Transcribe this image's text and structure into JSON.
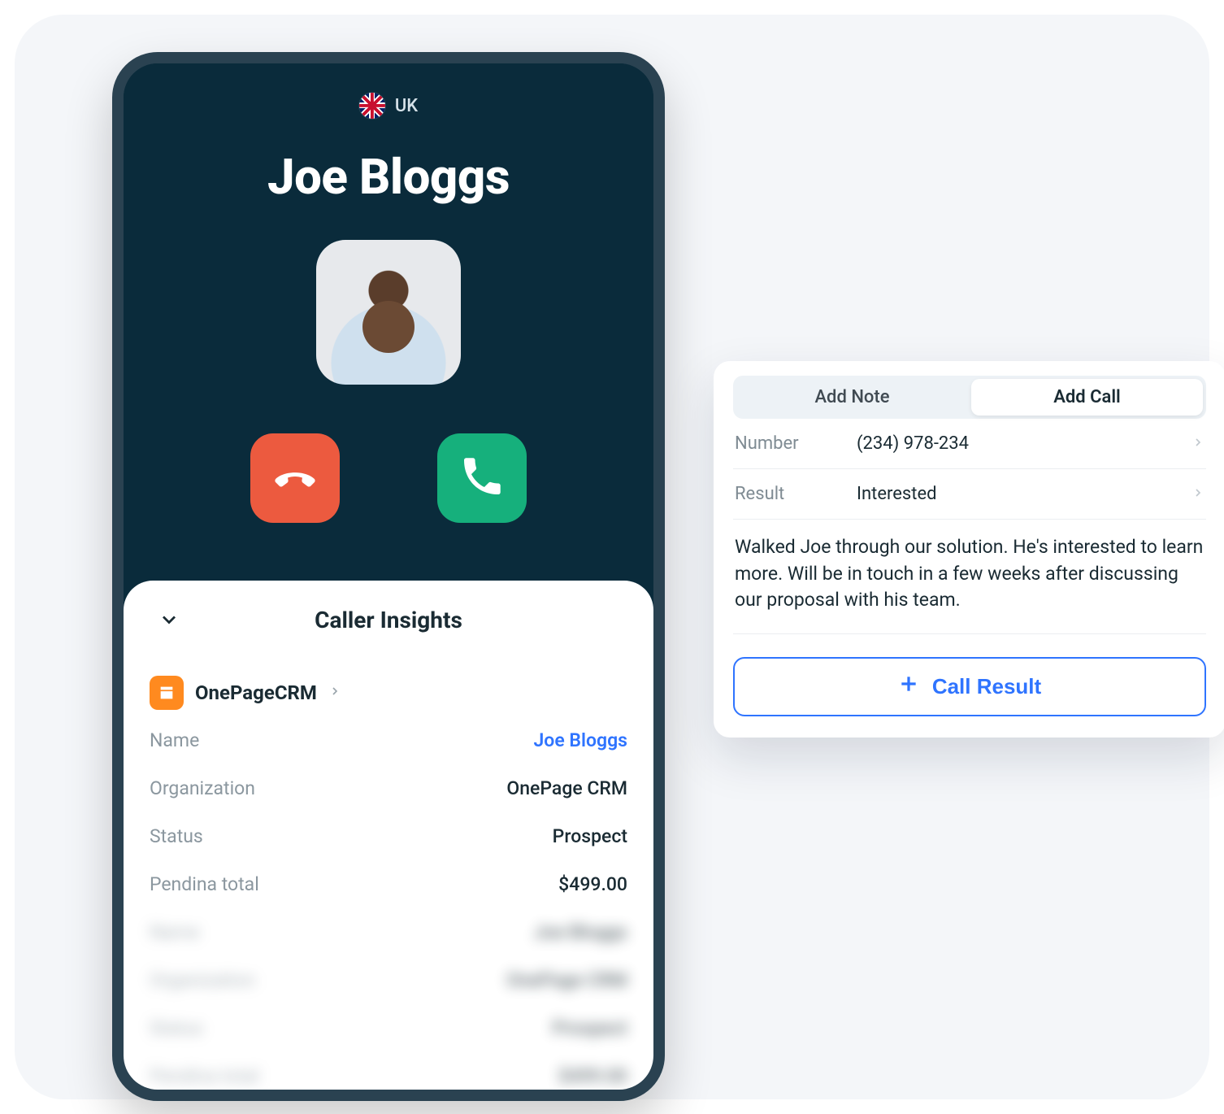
{
  "call": {
    "country_code": "UK",
    "caller_name": "Joe Bloggs"
  },
  "insights": {
    "title": "Caller Insights",
    "source_name": "OnePageCRM",
    "fields": [
      {
        "k": "Name",
        "v": "Joe Bloggs",
        "link": true
      },
      {
        "k": "Organization",
        "v": "OnePage CRM",
        "link": false
      },
      {
        "k": "Status",
        "v": "Prospect",
        "link": false
      },
      {
        "k": "Pendina total",
        "v": "$499.00",
        "link": false
      }
    ],
    "blurred_fields": [
      {
        "k": "Name",
        "v": "Joe Bloggs"
      },
      {
        "k": "Organization",
        "v": "OnePage CRM"
      },
      {
        "k": "Status",
        "v": "Prospect"
      },
      {
        "k": "Pendina total",
        "v": "$499.00"
      }
    ]
  },
  "popover": {
    "tabs": {
      "note": "Add Note",
      "call": "Add Call"
    },
    "active_tab": "call",
    "number_label": "Number",
    "number_value": "(234) 978-234",
    "result_label": "Result",
    "result_value": "Interested",
    "note_text": "Walked Joe through our solution. He's interested to learn more. Will be in touch in a few weeks after discussing our proposal with his team.",
    "cta": "Call Result"
  }
}
